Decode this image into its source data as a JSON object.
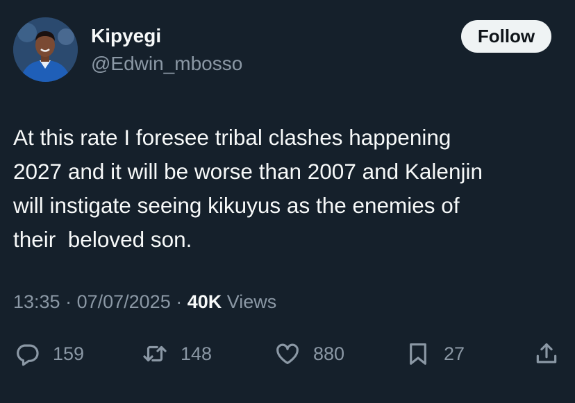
{
  "author": {
    "display_name": "Kipyegi",
    "handle": "@Edwin_mbosso"
  },
  "follow_button": {
    "label": "Follow"
  },
  "tweet": {
    "text": "At this rate I foresee tribal clashes happening\n2027 and it will be worse than 2007 and Kalenjin\nwill instigate seeing kikuyus as the enemies of\ntheir  beloved son.",
    "time": "13:35",
    "date": "07/07/2025",
    "separator": " · ",
    "views_count": "40K",
    "views_label": " Views"
  },
  "actions": {
    "replies": "159",
    "reposts": "148",
    "likes": "880",
    "bookmarks": "27"
  },
  "icons": {
    "reply": "reply-icon",
    "repost": "repost-icon",
    "like": "heart-icon",
    "bookmark": "bookmark-icon",
    "share": "share-icon"
  },
  "colors": {
    "background": "#15202b",
    "primary_text": "#f7f9f9",
    "secondary_text": "#8b98a5",
    "follow_bg": "#eff3f4"
  }
}
